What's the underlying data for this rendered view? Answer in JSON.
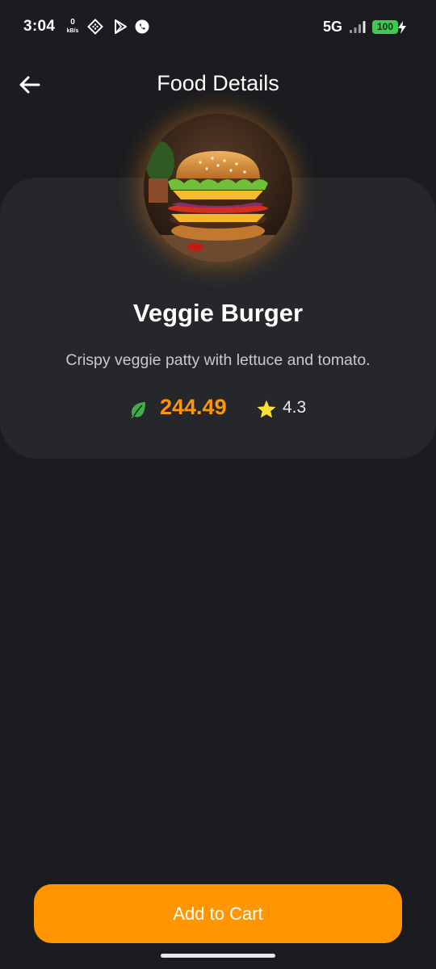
{
  "status_bar": {
    "time": "3:04",
    "speed_value": "0",
    "speed_unit": "kB/s",
    "network": "5G",
    "battery": "100",
    "icons": [
      "grid-app-icon",
      "play-store-icon",
      "whatsapp-icon",
      "signal-icon",
      "charging-bolt-icon"
    ]
  },
  "app_bar": {
    "title": "Food Details",
    "back_icon": "arrow-left-icon"
  },
  "food": {
    "name": "Veggie Burger",
    "description": "Crispy veggie patty with lettuce and tomato.",
    "price": "244.49",
    "rating": "4.3",
    "veg_icon": "leaf-icon",
    "rating_icon": "star-icon",
    "image_alt": "Cheeseburger with lettuce, tomato and onion"
  },
  "actions": {
    "add_to_cart_label": "Add to Cart"
  },
  "colors": {
    "background": "#1b1c20",
    "card": "#26272b",
    "accent": "#ff9500",
    "price": "#ff9508",
    "leaf": "#3cae4a",
    "star": "#ffe02e",
    "battery": "#3dcb4f"
  }
}
